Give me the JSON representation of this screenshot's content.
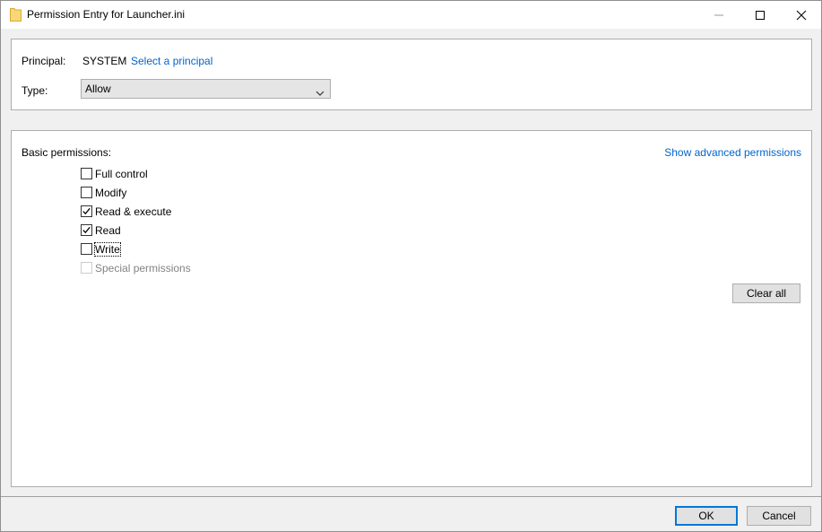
{
  "window": {
    "title": "Permission Entry for Launcher.ini"
  },
  "principal_section": {
    "principal_label": "Principal:",
    "principal_value": "SYSTEM",
    "select_principal_link": "Select a principal",
    "type_label": "Type:",
    "type_value": "Allow"
  },
  "permissions_section": {
    "heading": "Basic permissions:",
    "show_advanced_link": "Show advanced permissions",
    "items": [
      {
        "label": "Full control",
        "checked": false,
        "enabled": true
      },
      {
        "label": "Modify",
        "checked": false,
        "enabled": true
      },
      {
        "label": "Read & execute",
        "checked": true,
        "enabled": true
      },
      {
        "label": "Read",
        "checked": true,
        "enabled": true
      },
      {
        "label": "Write",
        "checked": false,
        "enabled": true,
        "focused": true
      },
      {
        "label": "Special permissions",
        "checked": false,
        "enabled": false
      }
    ],
    "clear_all_label": "Clear all"
  },
  "footer": {
    "ok_label": "OK",
    "cancel_label": "Cancel"
  },
  "colors": {
    "link": "#0066cc",
    "default_button_border": "#0078d7",
    "folder_icon": "#f8d775"
  },
  "icons": {
    "title_icon": "folder-icon",
    "minimize": "minimize-icon",
    "maximize": "maximize-icon",
    "close": "close-icon",
    "dropdown": "chevron-down-icon",
    "check": "checkmark-icon"
  }
}
